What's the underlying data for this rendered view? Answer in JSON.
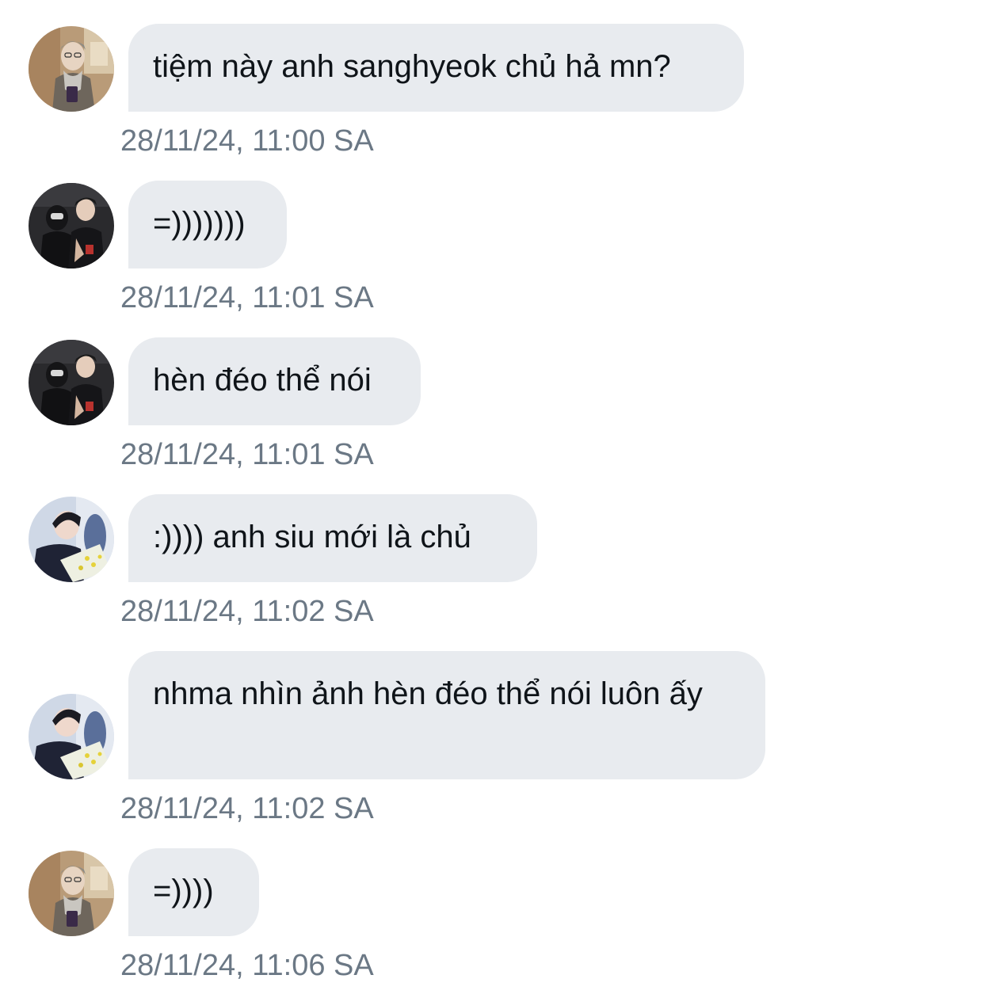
{
  "thread": {
    "messages": [
      {
        "avatar": "avatar-1",
        "text": "tiệm này anh sanghyeok chủ hả mn?",
        "time": "28/11/24, 11:00 SA"
      },
      {
        "avatar": "avatar-2",
        "text": "=)))))))",
        "time": "28/11/24, 11:01 SA"
      },
      {
        "avatar": "avatar-2",
        "text": "hèn đéo thể nói",
        "time": "28/11/24, 11:01 SA"
      },
      {
        "avatar": "avatar-3",
        "text": ":)))) anh siu mới là chủ",
        "time": "28/11/24, 11:02 SA"
      },
      {
        "avatar": "avatar-3",
        "text": "nhma nhìn ảnh hèn đéo thể nói luôn ấy",
        "time": "28/11/24, 11:02 SA"
      },
      {
        "avatar": "avatar-1",
        "text": "=))))",
        "time": "28/11/24, 11:06 SA"
      }
    ]
  },
  "colors": {
    "bubble": "#e8ebef",
    "text": "#0f1419",
    "timestamp": "#6b7885"
  }
}
